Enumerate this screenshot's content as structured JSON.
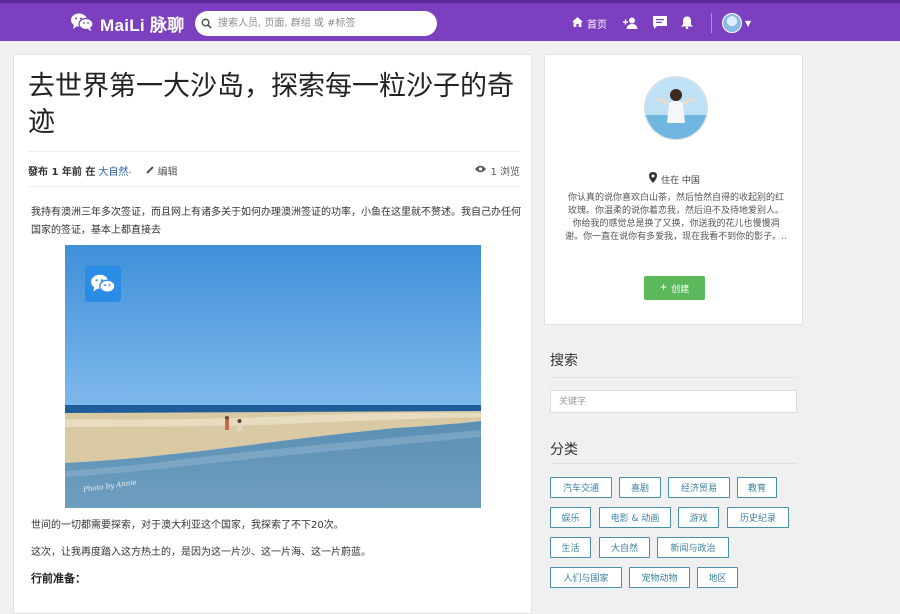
{
  "header": {
    "brand_name": "MaiLi 脉聊",
    "search_placeholder": "搜索人员, 页面, 群组 或 #标签",
    "home_label": "首页"
  },
  "article": {
    "title": "去世界第一大沙岛，探索每一粒沙子的奇迹",
    "meta": {
      "published_prefix": "發布 1 年前 在",
      "category": "大自然",
      "category_suffix": ".",
      "edit_label": "编辑",
      "views_label": "1 浏览"
    },
    "paragraphs": [
      "我持有澳洲三年多次签证，而且网上有诸多关于如何办理澳洲签证的功率，小鱼在这里就不赘述。我自己办任何国家的签证，基本上都直接去",
      "世间的一切都需要探索，对于澳大利亚这个国家，我探索了不下20次。",
      "这次，让我再度踏入这方热土的，是因为这一片沙、这一片海、这一片蔚蓝。"
    ],
    "subheading": "行前准备：",
    "photo_signature": "Photo by Annie"
  },
  "profile": {
    "location_label": "住在 中国",
    "bio": "你认真的说你喜欢白山茶，然后恰然自得的收起别的红玫瑰。你温柔的说你着恋我，然后迫不及待地爱别人。你给我的感觉总是换了又换，你送我的花儿也慢慢凋谢。你一直在说你有多爱我，现在我看不到你的影子。..",
    "create_label": "创建"
  },
  "sidebar": {
    "search_title": "搜索",
    "keyword_placeholder": "关键字",
    "category_title": "分类",
    "tags": [
      "汽车交通",
      "喜剧",
      "经济贸易",
      "教育",
      "娱乐",
      "电影 & 动画",
      "游戏",
      "历史纪录",
      "生活",
      "大自然",
      "新闻与政治",
      "人们与国家",
      "宠物动物",
      "地区"
    ]
  },
  "colors": {
    "topbar": "#7b3fc0",
    "link": "#2a5db0",
    "create_button": "#5cb85c",
    "tag_border": "#4a8fa8"
  },
  "icons": {
    "brand": "wechat-icon",
    "home": "home-icon",
    "add_user": "add-user-icon",
    "messages": "chat-icon",
    "notifications": "bell-icon",
    "location": "map-marker-icon",
    "edit": "pencil-icon",
    "views": "eye-icon"
  }
}
